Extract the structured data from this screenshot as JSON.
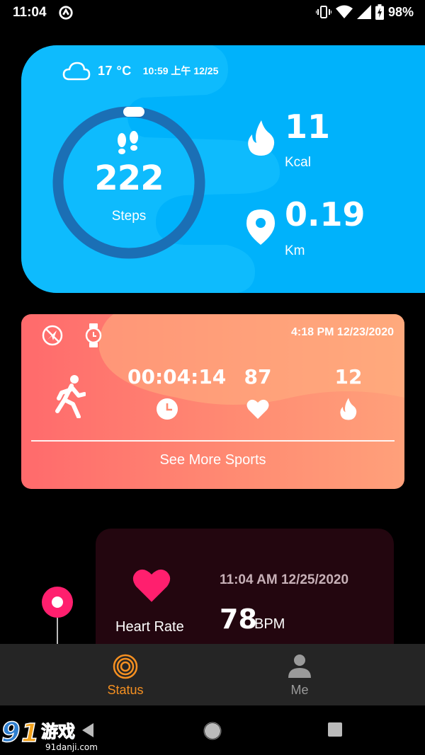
{
  "status_bar": {
    "time": "11:04",
    "battery": "98%"
  },
  "steps_card": {
    "temperature": "17 °C",
    "datetime": "10:59 上午 12/25",
    "steps_value": "222",
    "steps_label": "Steps",
    "kcal_value": "11",
    "kcal_label": "Kcal",
    "km_value": "0.19",
    "km_label": "Km",
    "steps_progress": 0.0,
    "colors": {
      "card": "#00B2FB",
      "ring": "#1B6FB5"
    }
  },
  "sport_card": {
    "datetime": "4:18 PM 12/23/2020",
    "duration": "00:04:14",
    "heart_rate": "87",
    "calories": "12",
    "see_more": "See More Sports"
  },
  "heart_card": {
    "label": "Heart Rate",
    "datetime": "11:04 AM 12/25/2020",
    "value": "78",
    "unit": "BPM",
    "accent": "#FF1F6E"
  },
  "tabs": [
    {
      "label": "Status",
      "icon": "status-rings-icon",
      "active": true
    },
    {
      "label": "Me",
      "icon": "person-icon",
      "active": false
    }
  ],
  "watermark": {
    "logo_text": "91游戏",
    "site": "91danji.com"
  }
}
